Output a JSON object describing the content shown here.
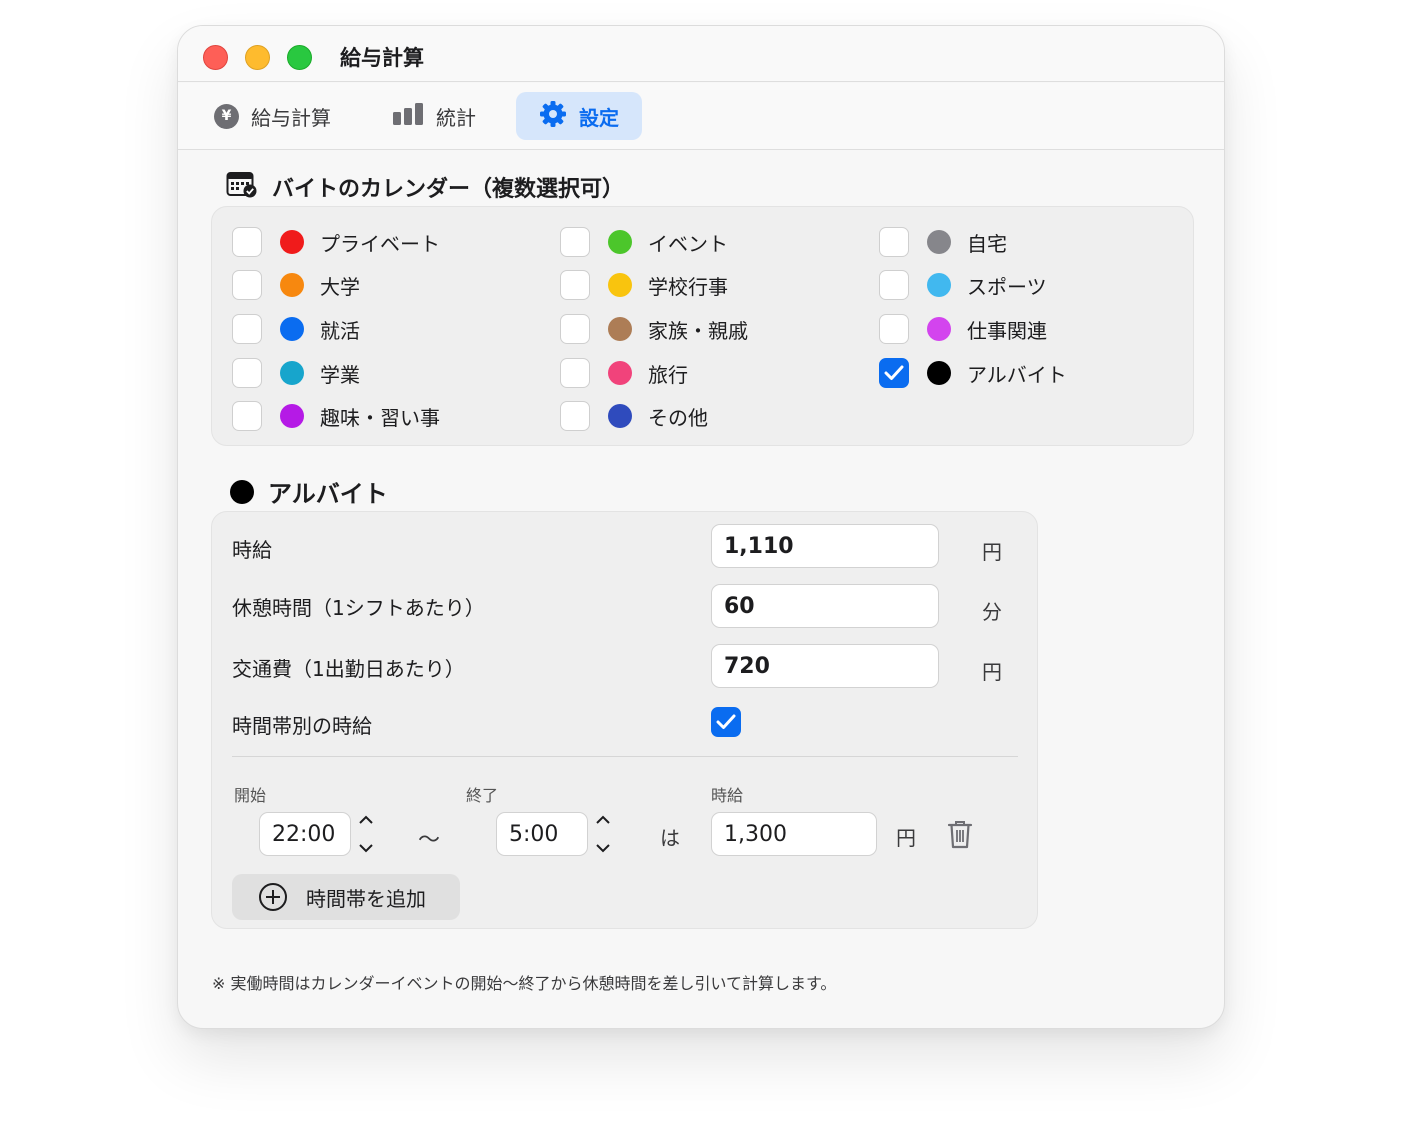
{
  "window": {
    "title": "給与計算"
  },
  "tabs": [
    {
      "label": "給与計算",
      "icon": "yen-icon",
      "yen_glyph": "¥"
    },
    {
      "label": "統計",
      "icon": "chart-icon"
    },
    {
      "label": "設定",
      "icon": "gear-icon",
      "selected": true
    }
  ],
  "calendar_section": {
    "title": "バイトのカレンダー（複数選択可）",
    "items": [
      {
        "label": "プライベート",
        "color": "#f01b1b",
        "checked": false
      },
      {
        "label": "イベント",
        "color": "#4cc62b",
        "checked": false
      },
      {
        "label": "自宅",
        "color": "#86868b",
        "checked": false
      },
      {
        "label": "大学",
        "color": "#f7880f",
        "checked": false
      },
      {
        "label": "学校行事",
        "color": "#f9c40e",
        "checked": false
      },
      {
        "label": "スポーツ",
        "color": "#41b8ef",
        "checked": false
      },
      {
        "label": "就活",
        "color": "#0a6cf0",
        "checked": false
      },
      {
        "label": "家族・親戚",
        "color": "#ad7d56",
        "checked": false
      },
      {
        "label": "仕事関連",
        "color": "#d344ee",
        "checked": false
      },
      {
        "label": "学業",
        "color": "#17a5cc",
        "checked": false
      },
      {
        "label": "旅行",
        "color": "#f1437b",
        "checked": false
      },
      {
        "label": "アルバイト",
        "color": "#000000",
        "checked": true
      },
      {
        "label": "趣味・習い事",
        "color": "#b51ae6",
        "checked": false
      },
      {
        "label": "その他",
        "color": "#2f4bbd",
        "checked": false
      }
    ]
  },
  "job_section": {
    "title": "アルバイト",
    "color": "#000000",
    "hourly_wage": {
      "label": "時給",
      "value": "1,110",
      "unit": "円"
    },
    "break_time": {
      "label": "休憩時間（1シフトあたり）",
      "value": "60",
      "unit": "分"
    },
    "transport": {
      "label": "交通費（1出勤日あたり）",
      "value": "720",
      "unit": "円"
    },
    "time_band": {
      "label": "時間帯別の時給",
      "checked": true
    },
    "band_row": {
      "start_label": "開始",
      "end_label": "終了",
      "wage_label": "時給",
      "start_value": "22:00",
      "tilde": "〜",
      "end_value": "5:00",
      "wa": "は",
      "wage_value": "1,300",
      "unit": "円"
    },
    "add_button": "時間帯を追加"
  },
  "note": "※ 実働時間はカレンダーイベントの開始〜終了から休憩時間を差し引いて計算します。"
}
